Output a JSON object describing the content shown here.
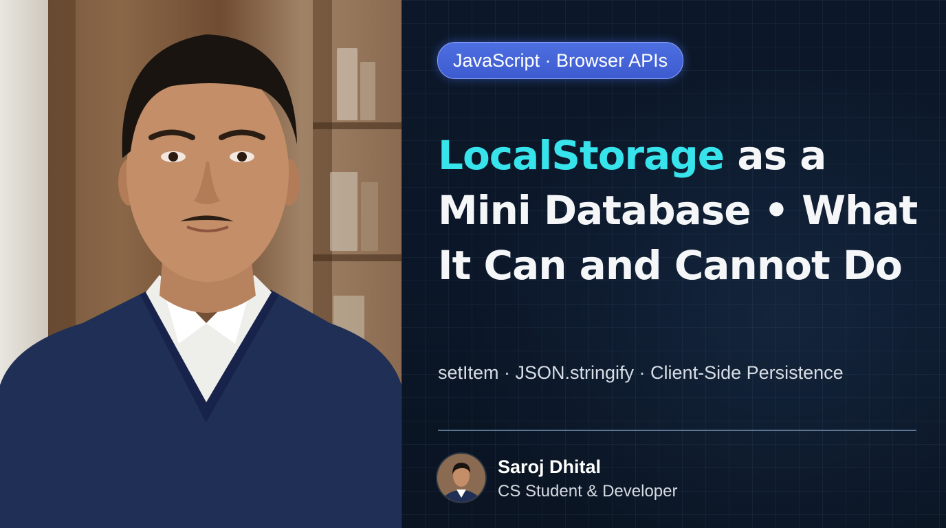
{
  "tag": "JavaScript · Browser APIs",
  "title": {
    "highlight": "LocalStorage",
    "rest": " as a Mini Database • What It Can and Cannot Do"
  },
  "subtitle": "setItem · JSON.stringify · Client-Side Persistence",
  "author": {
    "name": "Saroj Dhital",
    "role": "CS Student & Developer"
  },
  "colors": {
    "accent": "#37e4ec",
    "pill": "#4d6fe0",
    "background": "#0b1628"
  }
}
